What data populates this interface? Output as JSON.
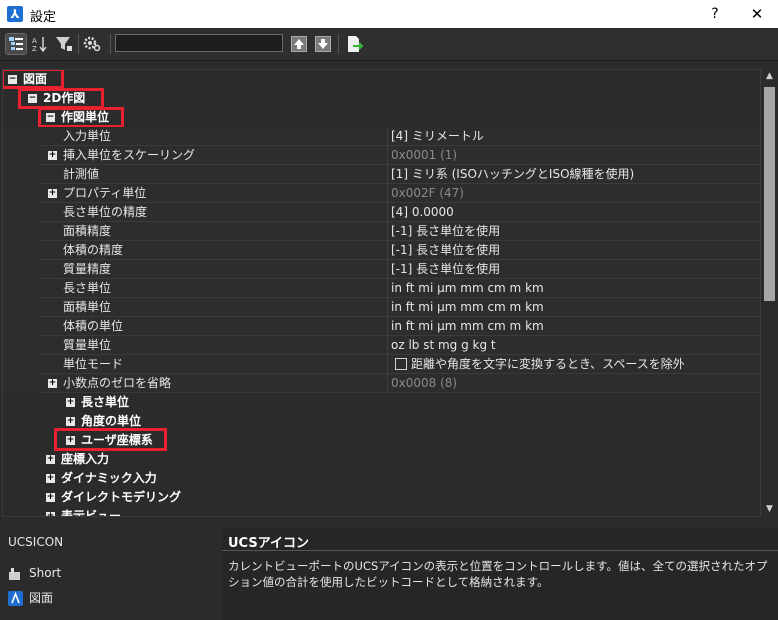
{
  "window": {
    "title": "設定",
    "help_label": "?",
    "close_label": "✕"
  },
  "toolbar": {
    "search_value": ""
  },
  "tree": {
    "root": "図面",
    "group_2d": "2D作図",
    "group_units": "作図単位",
    "properties": [
      {
        "label": "入力単位",
        "value": "[4] ミリメートル",
        "expandable": false
      },
      {
        "label": "挿入単位をスケーリング",
        "value": "0x0001 (1)",
        "expandable": true,
        "dim": true
      },
      {
        "label": "計測値",
        "value": "[1] ミリ系 (ISOハッチングとISO線種を使用)",
        "expandable": false
      },
      {
        "label": "プロパティ単位",
        "value": "0x002F (47)",
        "expandable": true,
        "dim": true
      },
      {
        "label": "長さ単位の精度",
        "value": "[4] 0.0000",
        "expandable": false
      },
      {
        "label": "面積精度",
        "value": "[-1] 長さ単位を使用",
        "expandable": false
      },
      {
        "label": "体積の精度",
        "value": "[-1] 長さ単位を使用",
        "expandable": false
      },
      {
        "label": "質量精度",
        "value": "[-1] 長さ単位を使用",
        "expandable": false
      },
      {
        "label": "長さ単位",
        "value": "in ft mi µm mm cm m km",
        "expandable": false
      },
      {
        "label": "面積単位",
        "value": "in ft mi µm mm cm m km",
        "expandable": false
      },
      {
        "label": "体積の単位",
        "value": "in ft mi µm mm cm m km",
        "expandable": false
      },
      {
        "label": "質量単位",
        "value": "oz lb st mg g kg t",
        "expandable": false
      },
      {
        "label": "単位モード",
        "value": "距離や角度を文字に変換するとき、スペースを除外",
        "expandable": false,
        "checkbox": true
      },
      {
        "label": "小数点のゼロを省略",
        "value": "0x0008 (8)",
        "expandable": true,
        "dim": true
      }
    ],
    "sub_groups": [
      "長さ単位",
      "角度の単位",
      "ユーザ座標系"
    ],
    "top_groups": [
      "座標入力",
      "ダイナミック入力",
      "ダイレクトモデリング",
      "表示ビュー"
    ]
  },
  "bottom": {
    "variable": "UCSICON",
    "items": [
      "Short",
      "図面"
    ],
    "info_title": "UCSアイコン",
    "info_desc": "カレントビューポートのUCSアイコンの表示と位置をコントロールします。値は、全ての選択されたオプション値の合計を使用したビットコードとして格納されます。"
  },
  "colors": {
    "highlight": "#e8212e",
    "accent": "#1f6fd1"
  }
}
